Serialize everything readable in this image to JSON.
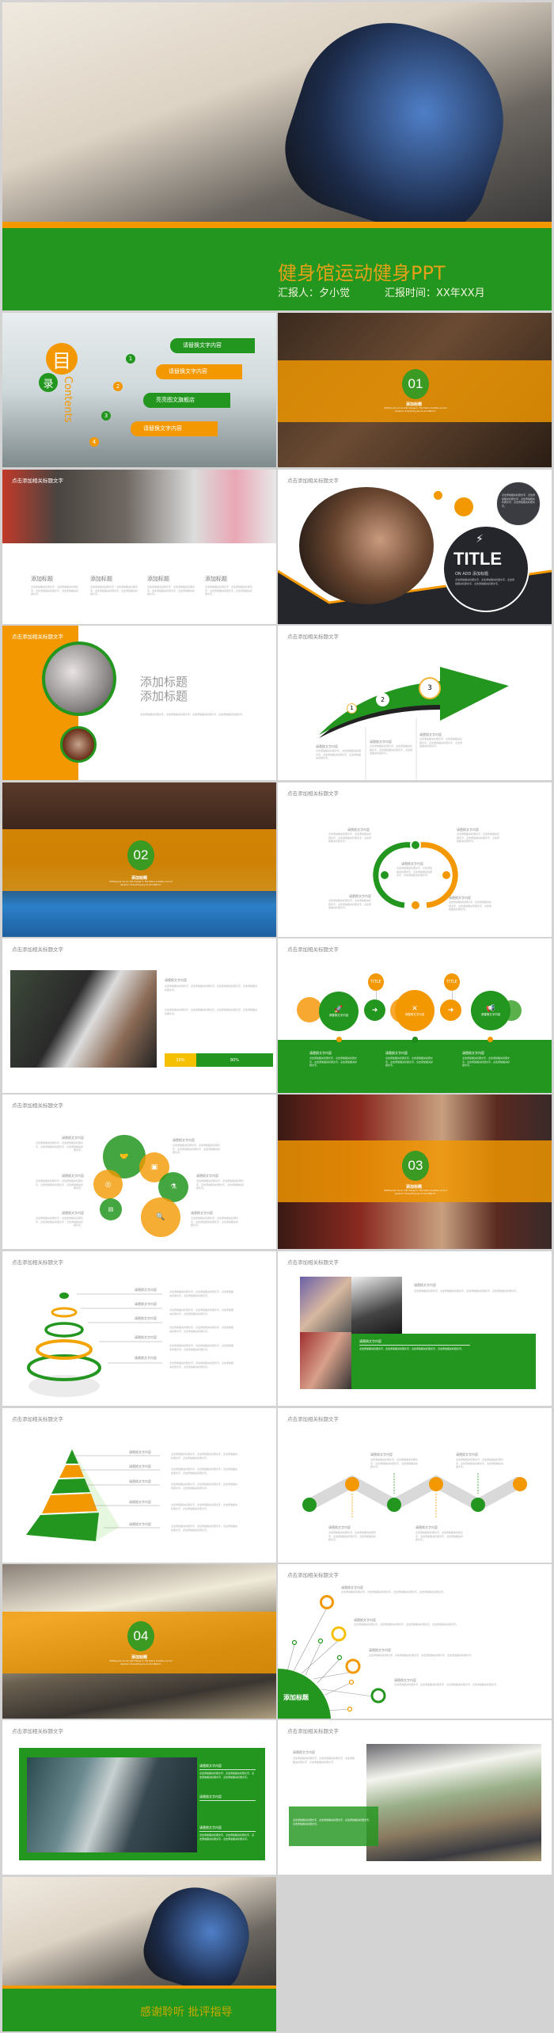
{
  "cover": {
    "title": "健身馆运动健身PPT",
    "reporter": "汇报人：夕小觉",
    "report_time": "汇报时间：XX年XX月"
  },
  "common": {
    "slide_header": "点击添加相关标题文字",
    "caption": "请替换文字内容",
    "add_title": "添加标题",
    "body": "点击添加相关标题文字，点击添加相关标题文字，点击添加相关标题文字，点击添加相关标题文字。",
    "tagline": "Nothing we can do will change it. The future is before us and dynamic. Everything we do will affect it."
  },
  "toc": {
    "mu": "目",
    "lu": "录",
    "contents": "Contents",
    "items": [
      {
        "num": "1",
        "label": "请替换文字内容"
      },
      {
        "num": "2",
        "label": "请替换文字内容"
      },
      {
        "num": "3",
        "label": "亮亮图文旗舰店"
      },
      {
        "num": "4",
        "label": "请替换文字内容"
      }
    ]
  },
  "sections": [
    {
      "num": "01"
    },
    {
      "num": "02"
    },
    {
      "num": "03"
    },
    {
      "num": "04"
    }
  ],
  "title_slide": {
    "title": "TITLE",
    "subtitle": "ON ADD 添加标题"
  },
  "arrow_steps": [
    "1",
    "2",
    "3"
  ],
  "progress": {
    "segments": [
      {
        "label": "20%",
        "value": 20,
        "color": "#f5c000"
      },
      {
        "label": "80%",
        "value": 80,
        "color": "#23961f"
      }
    ]
  },
  "bubbles": {
    "tags": [
      "TITLE",
      "TITLE"
    ]
  },
  "closing": {
    "text": "感谢聆听 批评指导"
  },
  "colors": {
    "green": "#23961f",
    "orange": "#f39800",
    "title_gold": "#e5a01a",
    "dark": "#24262c"
  }
}
